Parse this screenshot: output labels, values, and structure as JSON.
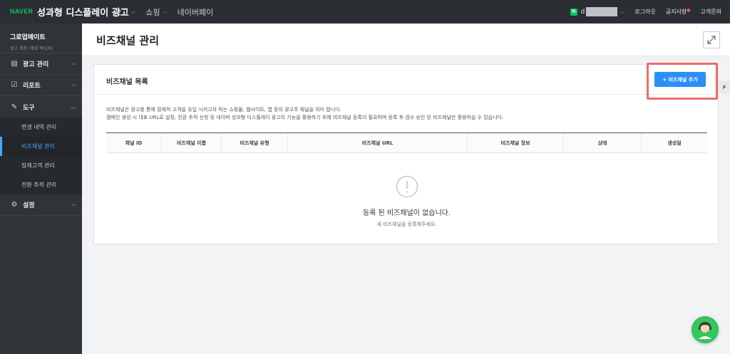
{
  "topbar": {
    "brand": "NAVER",
    "title": "성과형 디스플레이 광고",
    "nav": [
      {
        "label": "광고",
        "chevron": true
      },
      {
        "label": "쇼핑",
        "chevron": true
      },
      {
        "label": "네이버페이",
        "chevron": false
      }
    ],
    "account_badge": "N",
    "account_name": "d",
    "links": {
      "logout": "로그아웃",
      "notice": "공지사항",
      "support": "고객문의"
    }
  },
  "sidebar": {
    "account_name": "그로업메이트",
    "account_role": "광고 계정 (계정 책임자)",
    "groups": [
      {
        "label": "광고 관리",
        "icon": "ad-manage-icon"
      },
      {
        "label": "리포트",
        "icon": "report-icon"
      },
      {
        "label": "도구",
        "icon": "tool-icon"
      },
      {
        "label": "설정",
        "icon": "gear-icon"
      }
    ],
    "tool_items": [
      {
        "label": "변경 내역 관리"
      },
      {
        "label": "비즈채널 관리"
      },
      {
        "label": "잠재고객 관리"
      },
      {
        "label": "전환 추적 관리"
      }
    ]
  },
  "page": {
    "title": "비즈채널 관리"
  },
  "card": {
    "title": "비즈채널 목록",
    "add_button": "+ 비즈채널 추가",
    "side_tab": "F",
    "desc_line1": "비즈채널은 광고를 통해 잠재적 고객을 유입 시키고자 하는 쇼핑몰, 웹사이트, 앱 등의 광고주 채널을 의미 합니다.",
    "desc_line2": "캠페인 생성 시 대표 URL로 설정, 전환 추적 신청 등 네이버 성과형 디스플레이 광고의 기능을 활용하기 위해 비즈채널 등록이 필요하며 등록 후 검수 승인 된 비즈채널만 활용하실 수 있습니다.",
    "columns": [
      {
        "label": "채널 ID"
      },
      {
        "label": "비즈채널 이름"
      },
      {
        "label": "비즈채널 유형"
      },
      {
        "label": "비즈채널 URL"
      },
      {
        "label": "비즈채널 정보"
      },
      {
        "label": "상태"
      },
      {
        "label": "생성일"
      }
    ],
    "empty_title": "등록 된 비즈채널이 없습니다.",
    "empty_sub": "새 비즈채널을 등록해주세요."
  },
  "colors": {
    "accent": "#2c8ff7",
    "naver_green": "#03c75a",
    "highlight": "#f06a6a",
    "sidebar_bg": "#2f3439",
    "topbar_bg": "#2b2f33"
  }
}
